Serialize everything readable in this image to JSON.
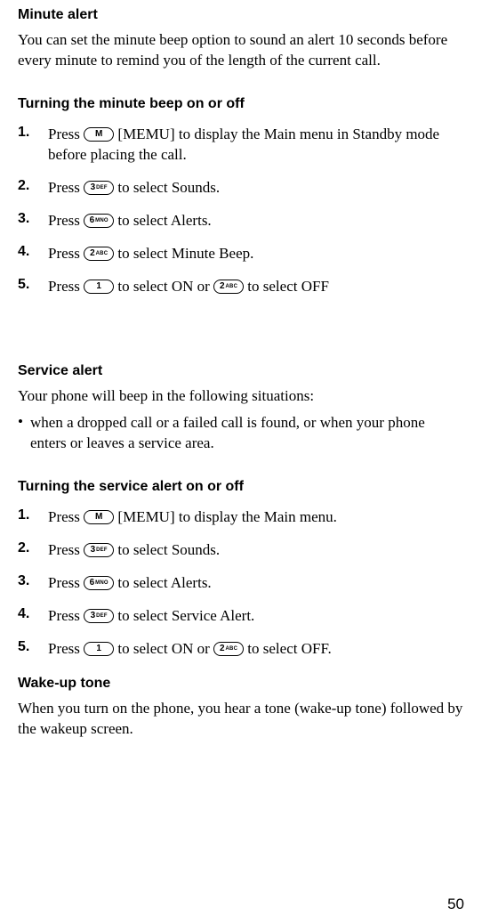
{
  "minuteAlert": {
    "heading": "Minute alert",
    "desc": "You can set the minute beep option to sound an alert 10 seconds before every minute to remind you of the length of the current call.",
    "subheading": "Turning the minute beep on or off",
    "steps": {
      "n1": "1.",
      "s1a": "Press ",
      "s1b": " [MEMU] to display the Main menu in Standby mode before placing the call.",
      "n2": "2.",
      "s2a": "Press ",
      "s2b": " to select Sounds.",
      "n3": "3.",
      "s3a": "Press ",
      "s3b": " to select Alerts.",
      "n4": "4.",
      "s4a": "Press ",
      "s4b": " to select Minute Beep.",
      "n5": "5.",
      "s5a": "Press ",
      "s5b": " to select ON or ",
      "s5c": " to select OFF"
    }
  },
  "serviceAlert": {
    "heading": "Service alert",
    "desc": "Your phone will beep in the following situations:",
    "bulletDot": "•",
    "bullet": "when a dropped call or a failed call is found, or when your phone enters or leaves a service area.",
    "subheading": "Turning the service alert on or off",
    "steps": {
      "n1": "1.",
      "s1a": "Press ",
      "s1b": " [MEMU] to display the Main menu.",
      "n2": "2.",
      "s2a": "Press ",
      "s2b": " to select Sounds.",
      "n3": "3.",
      "s3a": "Press ",
      "s3b": " to select Alerts.",
      "n4": "4.",
      "s4a": "Press ",
      "s4b": " to select Service Alert.",
      "n5": "5.",
      "s5a": "Press ",
      "s5b": " to select ON or ",
      "s5c": " to select OFF."
    }
  },
  "wakeUp": {
    "heading": "Wake-up tone",
    "desc": "When you turn on the phone, you hear a tone (wake-up tone) followed by the wakeup screen."
  },
  "keys": {
    "M": {
      "main": "M",
      "sub": ""
    },
    "1": {
      "main": "1",
      "sub": ""
    },
    "2": {
      "main": "2",
      "sub": "ABC"
    },
    "3": {
      "main": "3",
      "sub": "DEF"
    },
    "6": {
      "main": "6",
      "sub": "MNO"
    }
  },
  "pageNumber": "50"
}
